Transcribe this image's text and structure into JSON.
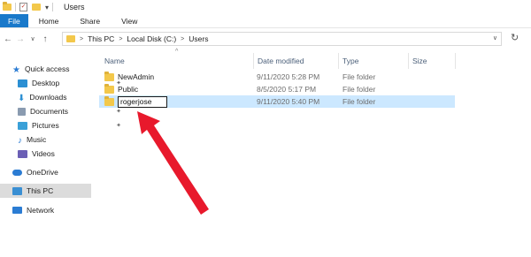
{
  "window": {
    "title": "Users"
  },
  "ribbon": {
    "tabs": [
      "File",
      "Home",
      "Share",
      "View"
    ]
  },
  "address": {
    "crumbs": [
      "This PC",
      "Local Disk (C:)",
      "Users"
    ]
  },
  "sidebar": {
    "items": [
      {
        "label": "Quick access",
        "icon": "star-icon",
        "color": "#2b7cd3"
      },
      {
        "label": "Desktop",
        "icon": "desktop-icon",
        "color": "#2b8fd3",
        "pinned": true
      },
      {
        "label": "Downloads",
        "icon": "download-icon",
        "color": "#2b8fd3",
        "pinned": true
      },
      {
        "label": "Documents",
        "icon": "documents-icon",
        "color": "#8a9bb0",
        "pinned": true
      },
      {
        "label": "Pictures",
        "icon": "pictures-icon",
        "color": "#3aa0d8",
        "pinned": true
      },
      {
        "label": "Music",
        "icon": "music-icon",
        "color": "#2b7cd3"
      },
      {
        "label": "Videos",
        "icon": "videos-icon",
        "color": "#6b5fb5"
      },
      {
        "label": "OneDrive",
        "icon": "cloud-icon",
        "color": "#2b7cd3"
      },
      {
        "label": "This PC",
        "icon": "computer-icon",
        "color": "#3a8fd3",
        "selected": true
      },
      {
        "label": "Network",
        "icon": "network-icon",
        "color": "#2b7cd3"
      }
    ]
  },
  "columns": {
    "name": "Name",
    "date": "Date modified",
    "type": "Type",
    "size": "Size"
  },
  "rows": [
    {
      "name": "NewAdmin",
      "date": "9/11/2020 5:28 PM",
      "type": "File folder"
    },
    {
      "name": "Public",
      "date": "8/5/2020 5:17 PM",
      "type": "File folder"
    },
    {
      "name": "rogerjose",
      "date": "9/11/2020 5:40 PM",
      "type": "File folder",
      "renaming": true
    }
  ],
  "colors": {
    "file_tab": "#1979ca",
    "selection": "#cce8ff",
    "folder": "#f3c84b",
    "annotation_arrow": "#e8192c"
  }
}
